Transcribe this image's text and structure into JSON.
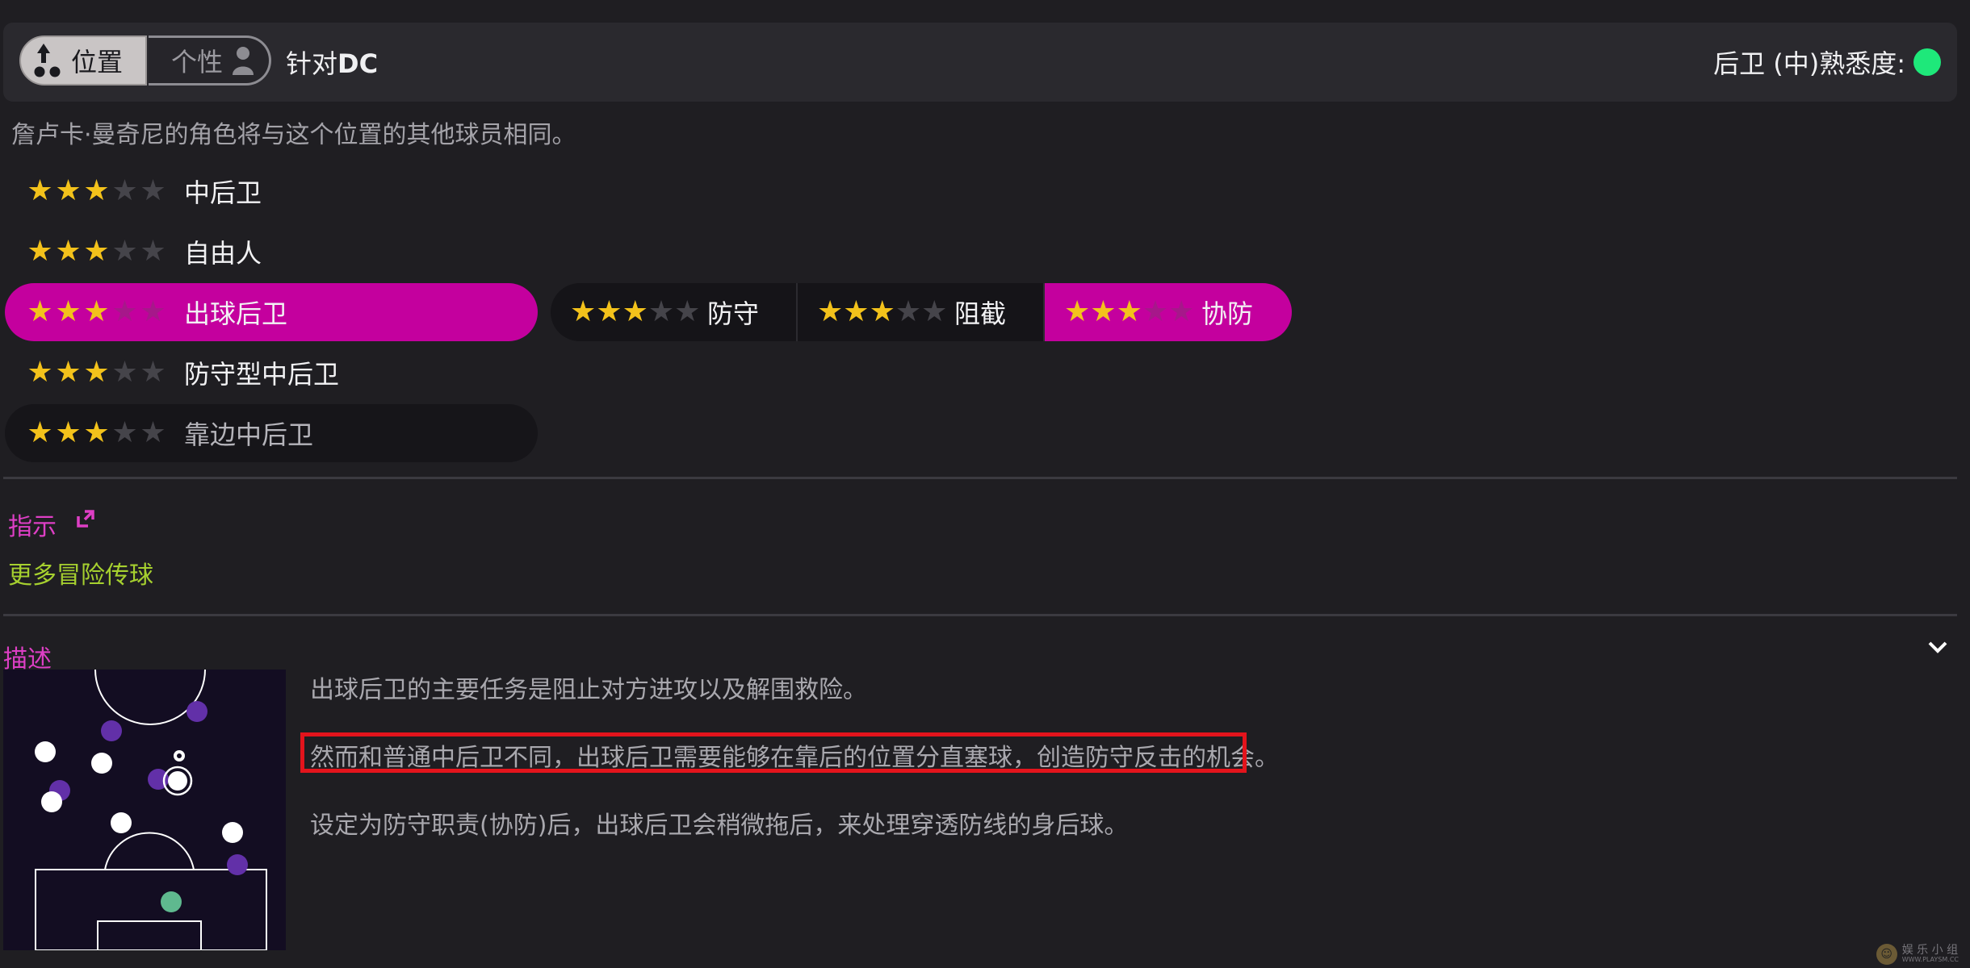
{
  "header": {
    "tab_position": "位置",
    "tab_personality": "个性",
    "vs_prefix": "针对",
    "vs_code": "DC",
    "familiarity_label": "后卫 (中)熟悉度:",
    "familiarity_color": "#1ee87a"
  },
  "subtitle": "詹卢卡·曼奇尼的角色将与这个位置的其他球员相同。",
  "roles": [
    {
      "label": "中后卫",
      "stars": 3,
      "max_stars": 5,
      "state": "normal"
    },
    {
      "label": "自由人",
      "stars": 3,
      "max_stars": 5,
      "state": "normal"
    },
    {
      "label": "出球后卫",
      "stars": 3,
      "max_stars": 5,
      "state": "selected"
    },
    {
      "label": "防守型中后卫",
      "stars": 3,
      "max_stars": 5,
      "state": "normal"
    },
    {
      "label": "靠边中后卫",
      "stars": 3,
      "max_stars": 5,
      "state": "dark"
    }
  ],
  "duties": [
    {
      "label": "防守",
      "stars": 3,
      "max_stars": 5,
      "selected": false
    },
    {
      "label": "阻截",
      "stars": 3,
      "max_stars": 5,
      "selected": false
    },
    {
      "label": "协防",
      "stars": 3,
      "max_stars": 5,
      "selected": true
    }
  ],
  "instructions": {
    "title": "指示",
    "items": [
      "更多冒险传球"
    ]
  },
  "description": {
    "title": "描述",
    "paragraphs": [
      "出球后卫的主要任务是阻止对方进攻以及解围救险。",
      "然而和普通中后卫不同，出球后卫需要能够在靠后的位置分直塞球，创造防守反击的机会。",
      "设定为防守职责(协防)后，出球后卫会稍微拖后，来处理穿透防线的身后球。"
    ]
  },
  "watermark": {
    "text": "娱 乐 小 组",
    "url": "WWW.PLAYSM.CC"
  },
  "colors": {
    "accent": "#c4009e",
    "section_title": "#de3fc5",
    "instruction_text": "#a6d02f",
    "star_on": "#f3c21b",
    "highlight": "#e3141c"
  }
}
